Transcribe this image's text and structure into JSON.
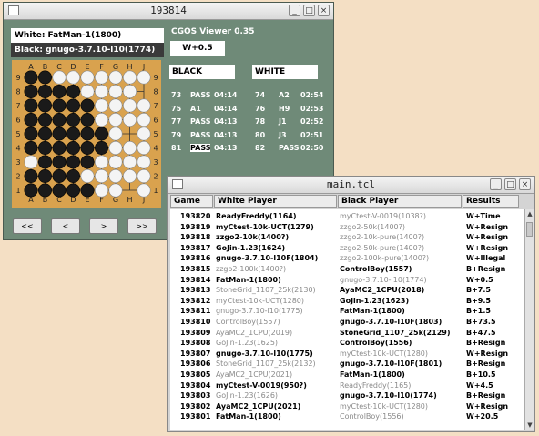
{
  "viewer_window": {
    "title": "193814",
    "white_player": "White: FatMan-1(1800)",
    "black_player": "Black: gnugo-3.7.10-l10(1774)",
    "app_name": "CGOS Viewer 0.35",
    "result": "W+0.5",
    "black_header": "BLACK",
    "white_header": "WHITE",
    "moves": [
      {
        "bn": "73",
        "bm": "PASS",
        "bt": "04:14",
        "wn": "74",
        "wm": "A2",
        "wt": "02:54"
      },
      {
        "bn": "75",
        "bm": "A1",
        "bt": "04:14",
        "wn": "76",
        "wm": "H9",
        "wt": "02:53"
      },
      {
        "bn": "77",
        "bm": "PASS",
        "bt": "04:13",
        "wn": "78",
        "wm": "J1",
        "wt": "02:52"
      },
      {
        "bn": "79",
        "bm": "PASS",
        "bt": "04:13",
        "wn": "80",
        "wm": "J3",
        "wt": "02:51"
      },
      {
        "bn": "81",
        "bm": "PASS",
        "bt": "04:13",
        "wn": "82",
        "wm": "PASS",
        "wt": "02:50"
      }
    ],
    "col_letters": [
      "A",
      "B",
      "C",
      "D",
      "E",
      "F",
      "G",
      "H",
      "J"
    ],
    "row_numbers": [
      "9",
      "8",
      "7",
      "6",
      "5",
      "4",
      "3",
      "2",
      "1"
    ],
    "board": [
      "BBWWWWWWW",
      "BBBBWWWW.",
      "BBBBBWWWW",
      "BBBBBWWWW",
      "BBBBBBW.W",
      "BBBBBBWWW",
      "WBBBBWWWW",
      "BBBBWWWWW",
      "BBBBBWW.W"
    ],
    "nav": [
      "<<",
      "<",
      ">",
      ">>"
    ]
  },
  "main_window": {
    "title": "main.tcl",
    "headers": [
      "Game",
      "White Player",
      "Black Player",
      "Results"
    ],
    "rows": [
      {
        "game": "193820",
        "white": "ReadyFreddy(1164)",
        "wb": true,
        "black": "myCtest-V-0019(1038?)",
        "bb": false,
        "result": "W+Time"
      },
      {
        "game": "193819",
        "white": "myCtest-10k-UCT(1279)",
        "wb": true,
        "black": "zzgo2-50k(1400?)",
        "bb": false,
        "result": "W+Resign"
      },
      {
        "game": "193818",
        "white": "zzgo2-10k(1400?)",
        "wb": true,
        "black": "zzgo2-10k-pure(1400?)",
        "bb": false,
        "result": "W+Resign"
      },
      {
        "game": "193817",
        "white": "GoJin-1.23(1624)",
        "wb": true,
        "black": "zzgo2-50k-pure(1400?)",
        "bb": false,
        "result": "W+Resign"
      },
      {
        "game": "193816",
        "white": "gnugo-3.7.10-l10F(1804)",
        "wb": true,
        "black": "zzgo2-100k-pure(1400?)",
        "bb": false,
        "result": "W+Illegal"
      },
      {
        "game": "193815",
        "white": "zzgo2-100k(1400?)",
        "wb": false,
        "black": "ControlBoy(1557)",
        "bb": true,
        "result": "B+Resign"
      },
      {
        "game": "193814",
        "white": "FatMan-1(1800)",
        "wb": true,
        "black": "gnugo-3.7.10-l10(1774)",
        "bb": false,
        "result": "W+0.5"
      },
      {
        "game": "193813",
        "white": "StoneGrid_1107_25k(2130)",
        "wb": false,
        "black": "AyaMC2_1CPU(2018)",
        "bb": true,
        "result": "B+7.5"
      },
      {
        "game": "193812",
        "white": "myCtest-10k-UCT(1280)",
        "wb": false,
        "black": "GoJin-1.23(1623)",
        "bb": true,
        "result": "B+9.5"
      },
      {
        "game": "193811",
        "white": "gnugo-3.7.10-l10(1775)",
        "wb": false,
        "black": "FatMan-1(1800)",
        "bb": true,
        "result": "B+1.5"
      },
      {
        "game": "193810",
        "white": "ControlBoy(1557)",
        "wb": false,
        "black": "gnugo-3.7.10-l10F(1803)",
        "bb": true,
        "result": "B+73.5"
      },
      {
        "game": "193809",
        "white": "AyaMC2_1CPU(2019)",
        "wb": false,
        "black": "StoneGrid_1107_25k(2129)",
        "bb": true,
        "result": "B+47.5"
      },
      {
        "game": "193808",
        "white": "GoJin-1.23(1625)",
        "wb": false,
        "black": "ControlBoy(1556)",
        "bb": true,
        "result": "B+Resign"
      },
      {
        "game": "193807",
        "white": "gnugo-3.7.10-l10(1775)",
        "wb": true,
        "black": "myCtest-10k-UCT(1280)",
        "bb": false,
        "result": "W+Resign"
      },
      {
        "game": "193806",
        "white": "StoneGrid_1107_25k(2132)",
        "wb": false,
        "black": "gnugo-3.7.10-l10F(1801)",
        "bb": true,
        "result": "B+Resign"
      },
      {
        "game": "193805",
        "white": "AyaMC2_1CPU(2021)",
        "wb": false,
        "black": "FatMan-1(1800)",
        "bb": true,
        "result": "B+10.5"
      },
      {
        "game": "193804",
        "white": "myCtest-V-0019(950?)",
        "wb": true,
        "black": "ReadyFreddy(1165)",
        "bb": false,
        "result": "W+4.5"
      },
      {
        "game": "193803",
        "white": "GoJin-1.23(1626)",
        "wb": false,
        "black": "gnugo-3.7.10-l10(1774)",
        "bb": true,
        "result": "B+Resign"
      },
      {
        "game": "193802",
        "white": "AyaMC2_1CPU(2021)",
        "wb": true,
        "black": "myCtest-10k-UCT(1280)",
        "bb": false,
        "result": "W+Resign"
      },
      {
        "game": "193801",
        "white": "FatMan-1(1800)",
        "wb": true,
        "black": "ControlBoy(1556)",
        "bb": false,
        "result": "W+20.5"
      }
    ]
  }
}
